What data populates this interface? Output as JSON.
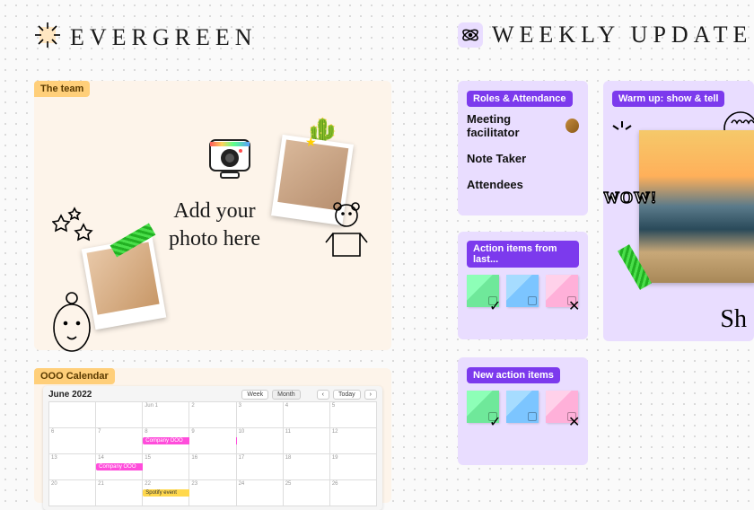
{
  "left": {
    "title": "EVERGREEN",
    "team_tag": "The team",
    "add_photo_line1": "Add your",
    "add_photo_line2": "photo here",
    "ooo_tag": "OOO Calendar",
    "calendar": {
      "month": "June 2022",
      "views": [
        "Week",
        "Month"
      ],
      "nav_today": "Today",
      "events": [
        {
          "label": "Company OOO",
          "color": "#ff4ddb"
        },
        {
          "label": "Company OOO",
          "color": "#ff4ddb"
        },
        {
          "label": "Spotify event",
          "color": "#ffd84d"
        }
      ]
    }
  },
  "right": {
    "title": "WEEKLY UPDATE",
    "roles": {
      "tag": "Roles & Attendance",
      "facilitator": "Meeting facilitator",
      "note_taker": "Note Taker",
      "attendees": "Attendees"
    },
    "action_last_tag": "Action items from last...",
    "new_action_tag": "New action items",
    "warmup_tag": "Warm up: show & tell",
    "wow": "WOW!",
    "share_initial": "Sh"
  },
  "icons": {
    "sparkle": "sparkle-icon",
    "atom": "atom-icon",
    "camera": "camera-icon",
    "cactus": "cactus-icon",
    "star_doodle": "star-doodle",
    "bear": "bear-doodle",
    "face": "face-doodle",
    "heart_face": "heart-face-doodle",
    "rays": "rays-doodle"
  }
}
